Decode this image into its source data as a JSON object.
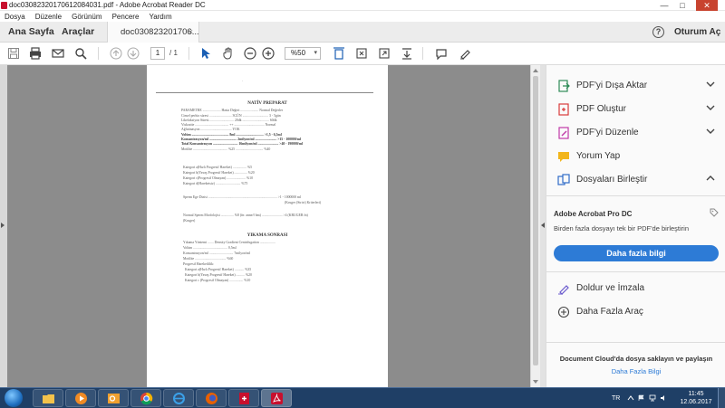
{
  "window": {
    "title": "doc03082320170612084031.pdf - Adobe Acrobat Reader DC",
    "minimize_glyph": "—",
    "maximize_glyph": "□",
    "close_glyph": "✕"
  },
  "menu": [
    "Dosya",
    "Düzenle",
    "Görünüm",
    "Pencere",
    "Yardım"
  ],
  "nav": {
    "home": "Ana Sayfa",
    "tools": "Araçlar",
    "doc_tab": "doc030823201706...",
    "doc_tab_close": "×",
    "help_glyph": "?",
    "signin": "Oturum Aç"
  },
  "toolbar": {
    "page_current": "1",
    "page_total": "/ 1",
    "zoom": "%50",
    "zoom_arrow": "▾"
  },
  "document": {
    "marker": "·",
    "title1": "NATİV PREPARAT",
    "title2": "YIKAMA SONRASI",
    "lines": [
      "PARAMETRE ..................... Hasta Değeri ..................... Normal Değerler",
      "Cinsel perhiz süresi .......................... 3GÜN .............................. 3 - 5gün",
      "Likefaksiyon Süresi ............................ 20dk ............................... 60dk",
      "Viskozite ....................................... ++ ................................... Normal",
      "Ağlutinasyon .................................... YOK",
      "Volüm ........................................... 8ml ................................ >1,5 - 6,5ml",
      "Konsantrasyon/ml ................................ 2milyon/ml ......................... >15 - 100000/ml",
      "Total Konsantrasyon ............................. 16milyon/ml ........................ >40 - 190000/ml",
      "Motilite ........................................ %25 ................................ %40",
      "Kategori a(Hızlı Progresif Hareket) ................ %5",
      "Kategori b(Yavaş Progresif Hareket) ............... %20",
      "Kategori c(Progresif Olmayan) ...................... %10",
      "Kategori d(Hareketsiz) ............................. %75",
      "Sperm Ege Dizisi ................................................................................ >1 - 1000000 ml",
      "(Kruger (Strict) Kriterleri)",
      "Normal Sperm Morfolojisi ............... %8 (fn: anne/f hm) ........................ >4  (KRUGER fn)",
      "(Kruger)",
      "Yıkama Yöntemi ....... Density Gradient Centrifugation ..................",
      "Volüm ........................................ 0,5ml",
      "Konsantrasyon/ml ............................ 7milyon/ml",
      "Motilite .................................... %60",
      "Progresif Hareketlilik:",
      "Kategori a(Hızlı Progresif Hareket) ........... %35",
      "Kategori b(Yavaş Progresif Hareket) .......... %20",
      "Kategori c (Progresif Olmayan) ................ %10"
    ]
  },
  "right_panel": {
    "tools": [
      {
        "label": "PDF'yi Dışa Aktar",
        "icon": "export-pdf-icon",
        "color": "#2e8b57"
      },
      {
        "label": "PDF Oluştur",
        "icon": "create-pdf-icon",
        "color": "#d83b3b"
      },
      {
        "label": "PDF'yi Düzenle",
        "icon": "edit-pdf-icon",
        "color": "#c03aa8"
      },
      {
        "label": "Yorum Yap",
        "icon": "comment-icon",
        "color": "#f2b51b"
      },
      {
        "label": "Dosyaları Birleştir",
        "icon": "combine-files-icon",
        "color": "#2f6cc7"
      }
    ],
    "promo": {
      "title": "Adobe Acrobat Pro DC",
      "description": "Birden fazla dosyayı tek bir PDF'de birleştirin",
      "button": "Daha fazla bilgi"
    },
    "extra_tools": [
      {
        "label": "Doldur ve İmzala",
        "icon": "fill-sign-icon"
      },
      {
        "label": "Daha Fazla Araç",
        "icon": "more-tools-icon"
      }
    ],
    "cloud": {
      "title": "Document Cloud'da dosya saklayın ve paylaşın",
      "link": "Daha Fazla Bilgi"
    }
  },
  "taskbar": {
    "lang": "TR",
    "time": "11:45",
    "date": "12.06.2017"
  },
  "colors": {
    "accent": "#2d7bd6",
    "taskbar": "#1f3f66"
  }
}
